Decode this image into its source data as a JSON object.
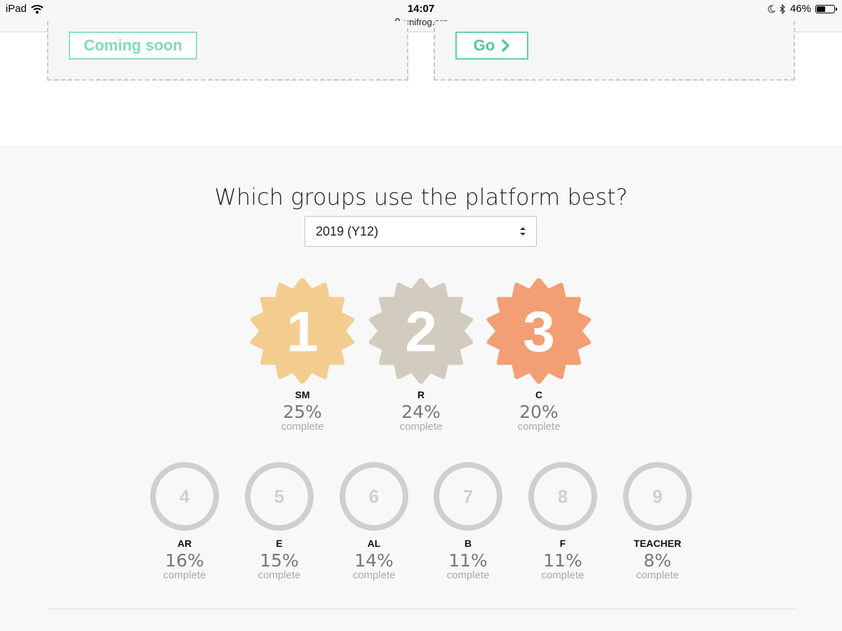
{
  "status_bar": {
    "device": "iPad",
    "time": "14:07",
    "url": "unifrog.org",
    "battery": "46%",
    "battery_level": 0.46
  },
  "cards": {
    "left_button": "Coming soon",
    "right_button": "Go"
  },
  "section": {
    "heading": "Which groups use the platform best?",
    "select_value": "2019 (Y12)"
  },
  "podium": [
    {
      "rank": "1",
      "group": "SM",
      "percent": "25%",
      "label": "complete",
      "color": "#f3cd90"
    },
    {
      "rank": "2",
      "group": "R",
      "percent": "24%",
      "label": "complete",
      "color": "#d2cbbf"
    },
    {
      "rank": "3",
      "group": "C",
      "percent": "20%",
      "label": "complete",
      "color": "#f39e74"
    }
  ],
  "ranks": [
    {
      "rank": "4",
      "group": "AR",
      "percent": "16%",
      "label": "complete"
    },
    {
      "rank": "5",
      "group": "E",
      "percent": "15%",
      "label": "complete"
    },
    {
      "rank": "6",
      "group": "AL",
      "percent": "14%",
      "label": "complete"
    },
    {
      "rank": "7",
      "group": "B",
      "percent": "11%",
      "label": "complete"
    },
    {
      "rank": "8",
      "group": "F",
      "percent": "11%",
      "label": "complete"
    },
    {
      "rank": "9",
      "group": "TEACHER",
      "percent": "8%",
      "label": "complete"
    }
  ],
  "colors": {
    "accent_green": "#4fc898",
    "circle_grey": "#cfcfcf"
  },
  "icons": [
    "wifi-icon",
    "lock-icon",
    "moon-icon",
    "bluetooth-icon",
    "battery-icon",
    "chevron-right-icon",
    "select-arrows-icon"
  ]
}
